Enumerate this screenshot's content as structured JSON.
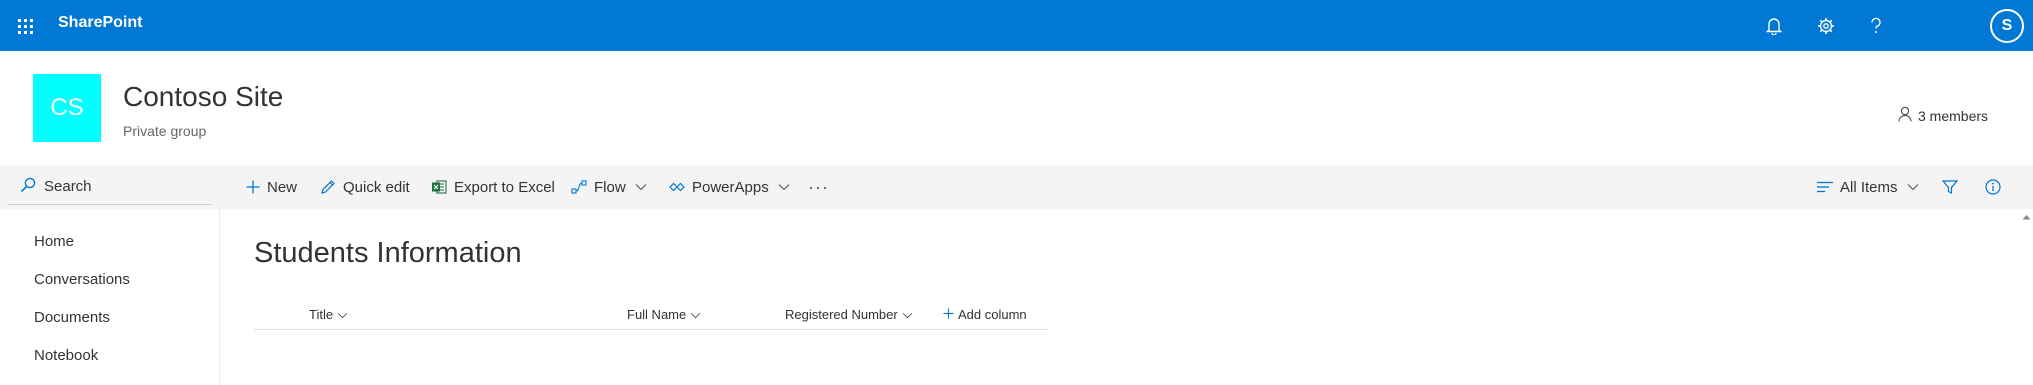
{
  "suite_bar": {
    "app_name": "SharePoint",
    "avatar_initials": "S",
    "icons": [
      "app-launcher-icon",
      "bell-icon",
      "gear-icon",
      "help-icon"
    ],
    "bg_color": "#0078d4"
  },
  "site": {
    "logo_initials": "CS",
    "logo_color": "#00ffff",
    "title": "Contoso Site",
    "subtitle": "Private group",
    "members_label": "3 members"
  },
  "search": {
    "label": "Search"
  },
  "command_bar": {
    "new_label": "New",
    "quick_edit_label": "Quick edit",
    "export_label": "Export to Excel",
    "flow_label": "Flow",
    "powerapps_label": "PowerApps",
    "more_label": "···",
    "view_label": "All Items"
  },
  "nav": {
    "items": [
      {
        "label": "Home"
      },
      {
        "label": "Conversations"
      },
      {
        "label": "Documents"
      },
      {
        "label": "Notebook"
      }
    ]
  },
  "list": {
    "title": "Students Information",
    "columns": [
      {
        "label": "Title"
      },
      {
        "label": "Full Name"
      },
      {
        "label": "Registered Number"
      }
    ],
    "add_column_label": "Add column"
  }
}
